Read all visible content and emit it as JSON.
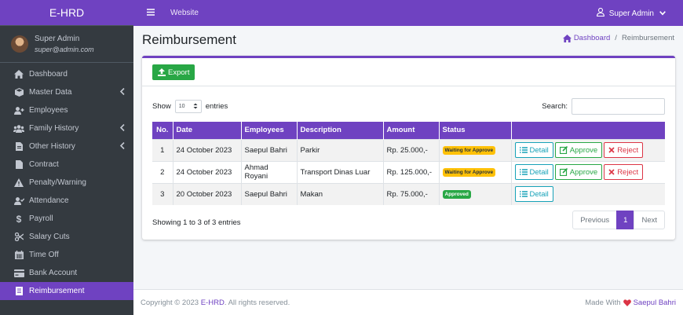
{
  "app": {
    "brand": "E-HRD",
    "accent_color": "#6f42c1",
    "sidebar_bg": "#343a40"
  },
  "sidebar": {
    "user": {
      "name": "Super Admin",
      "email": "super@admin.com"
    },
    "items": [
      {
        "label": "Dashboard",
        "icon": "home-icon",
        "has_submenu": false,
        "active": false
      },
      {
        "label": "Master Data",
        "icon": "cube-icon",
        "has_submenu": true,
        "active": false
      },
      {
        "label": "Employees",
        "icon": "user-plus-icon",
        "has_submenu": false,
        "active": false
      },
      {
        "label": "Family History",
        "icon": "users-icon",
        "has_submenu": true,
        "active": false
      },
      {
        "label": "Other History",
        "icon": "file-icon",
        "has_submenu": true,
        "active": false
      },
      {
        "label": "Contract",
        "icon": "file-icon",
        "has_submenu": false,
        "active": false
      },
      {
        "label": "Penalty/Warning",
        "icon": "warning-icon",
        "has_submenu": false,
        "active": false
      },
      {
        "label": "Attendance",
        "icon": "user-check-icon",
        "has_submenu": false,
        "active": false
      },
      {
        "label": "Payroll",
        "icon": "dollar-icon",
        "has_submenu": false,
        "active": false
      },
      {
        "label": "Salary Cuts",
        "icon": "scissors-icon",
        "has_submenu": false,
        "active": false
      },
      {
        "label": "Time Off",
        "icon": "calendar-icon",
        "has_submenu": false,
        "active": false
      },
      {
        "label": "Bank Account",
        "icon": "card-icon",
        "has_submenu": false,
        "active": false
      },
      {
        "label": "Reimbursement",
        "icon": "receipt-icon",
        "has_submenu": false,
        "active": true
      }
    ]
  },
  "topbar": {
    "website_label": "Website",
    "user_label": "Super Admin"
  },
  "page": {
    "title": "Reimbursement",
    "breadcrumb": {
      "home": "Dashboard",
      "current": "Reimbursement"
    }
  },
  "toolbar": {
    "export_label": "Export"
  },
  "table_controls": {
    "show_label": "Show",
    "entries_value": "10",
    "entries_label": "entries",
    "search_label": "Search:"
  },
  "table": {
    "columns": [
      "No.",
      "Date",
      "Employees",
      "Description",
      "Amount",
      "Status",
      ""
    ],
    "rows": [
      {
        "no": "1",
        "date": "24 October 2023",
        "employee": "Saepul Bahri",
        "description": "Parkir",
        "amount": "Rp. 25.000,-",
        "status": "Waiting for Approve",
        "status_color": "#ffc107"
      },
      {
        "no": "2",
        "date": "24 October 2023",
        "employee": "Ahmad Royani",
        "description": "Transport Dinas Luar",
        "amount": "Rp. 125.000,-",
        "status": "Waiting for Approve",
        "status_color": "#ffc107"
      },
      {
        "no": "3",
        "date": "20 October 2023",
        "employee": "Saepul Bahri",
        "description": "Makan",
        "amount": "Rp. 75.000,-",
        "status": "Approved",
        "status_color": "#28a745"
      }
    ],
    "actions": {
      "detail": "Detail",
      "approve": "Approve",
      "reject": "Reject"
    }
  },
  "pagination": {
    "info": "Showing 1 to 3 of 3 entries",
    "previous": "Previous",
    "current_page": "1",
    "next": "Next"
  },
  "footer": {
    "copyright_prefix": "Copyright © 2023",
    "copyright_brand": "E-HRD",
    "copyright_suffix": ". All rights reserved.",
    "made_with": "Made With",
    "author": "Saepul Bahri"
  }
}
